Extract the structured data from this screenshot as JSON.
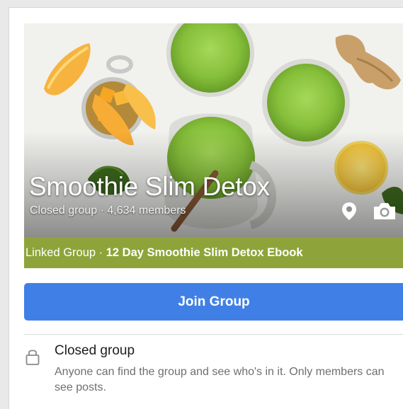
{
  "group": {
    "name": "Smoothie Slim Detox",
    "meta": "Closed group · 4,634 members"
  },
  "cover": {
    "icons": [
      "place-icon",
      "camera-icon"
    ]
  },
  "linked_group": {
    "prefix": "Linked Group · ",
    "title": "12 Day Smoothie Slim Detox Ebook"
  },
  "actions": {
    "join_label": "Join Group"
  },
  "privacy": {
    "title": "Closed group",
    "description": "Anyone can find the group and see who's in it. Only members can see posts."
  },
  "colors": {
    "linked_strip": "#8ea43a",
    "join_button": "#4080e6",
    "smoothie": "#8cc63f"
  }
}
